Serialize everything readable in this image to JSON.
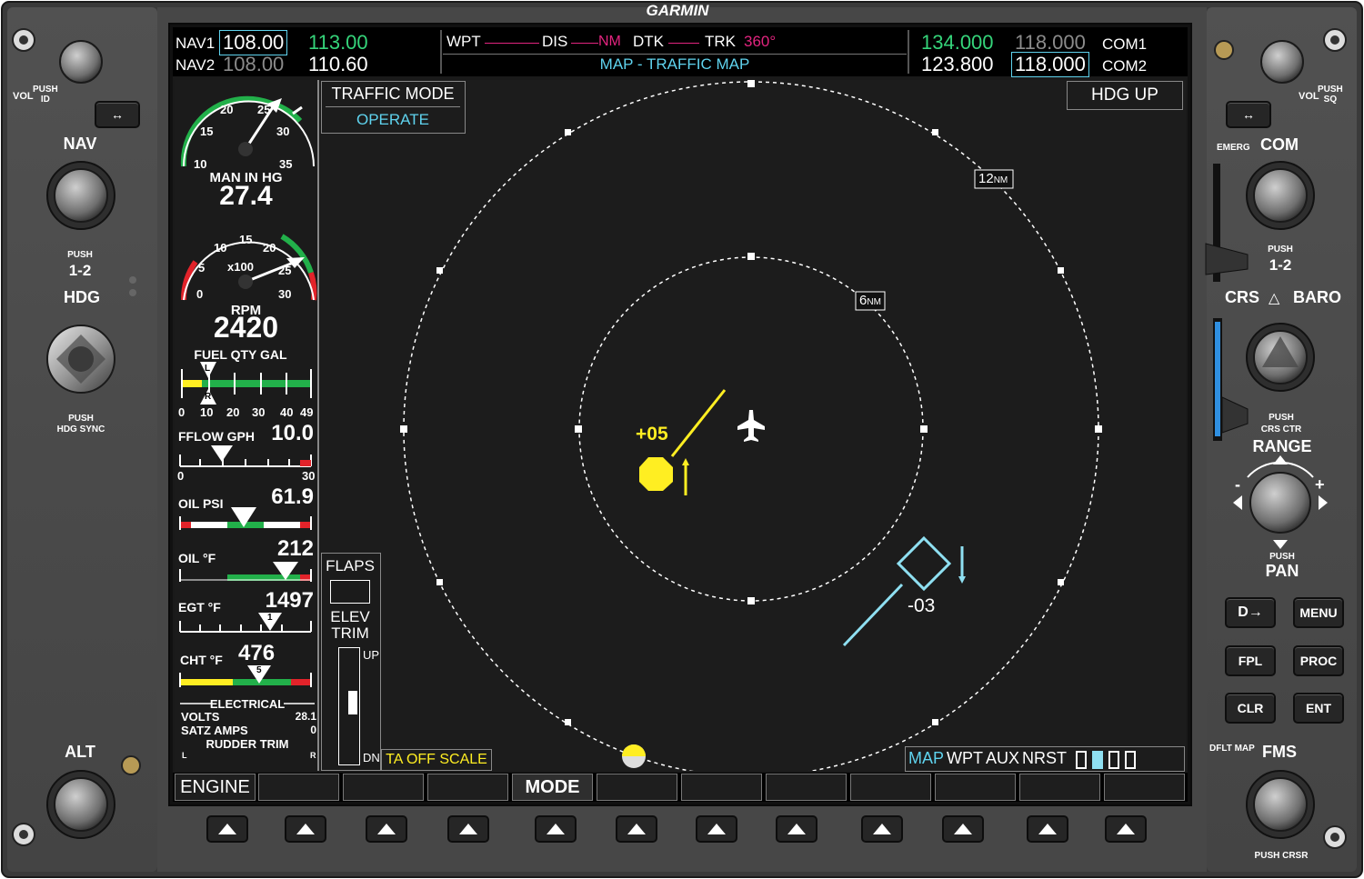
{
  "brand": "GARMIN",
  "nav": {
    "nav1_label": "NAV1",
    "nav1_active": "108.00",
    "nav1_standby": "113.00",
    "nav2_label": "NAV2",
    "nav2_active": "108.00",
    "nav2_standby": "110.60"
  },
  "nav_bar": {
    "wpt": "WPT",
    "dis": "DIS",
    "dis_unit": "NM",
    "dtk": "DTK",
    "trk": "TRK",
    "trk_value": "360°",
    "page_title": "MAP - TRAFFIC MAP"
  },
  "com": {
    "com1_active": "134.000",
    "com1_standby": "118.000",
    "com1_label": "COM1",
    "com2_active": "123.800",
    "com2_standby": "118.000",
    "com2_label": "COM2"
  },
  "map": {
    "traffic_mode_label": "TRAFFIC MODE",
    "traffic_mode_value": "OPERATE",
    "orientation": "HDG UP",
    "ring_outer": "12",
    "ring_inner": "6",
    "ring_unit": "NM",
    "ta_scale": "TA OFF SCALE",
    "target1_alt": "+05",
    "target2_alt": "-03",
    "page_groups": [
      "MAP",
      "WPT",
      "AUX",
      "NRST"
    ]
  },
  "eis": {
    "map_gauge_ticks": [
      "10",
      "15",
      "20",
      "25",
      "30",
      "35"
    ],
    "map_label": "MAN IN HG",
    "map_value": "27.4",
    "rpm_ticks": [
      "0",
      "5",
      "10",
      "15",
      "20",
      "25",
      "30"
    ],
    "rpm_mult": "x100",
    "rpm_label": "RPM",
    "rpm_value": "2420",
    "fuel_label": "FUEL QTY GAL",
    "fuel_left": "L",
    "fuel_right": "R",
    "fuel_ticks": [
      "0",
      "10",
      "20",
      "30",
      "40",
      "49"
    ],
    "fflow_label": "FFLOW GPH",
    "fflow_value": "10.0",
    "fflow_min": "0",
    "fflow_max": "30",
    "oilpsi_label": "OIL PSI",
    "oilpsi_value": "61.9",
    "oilf_label": "OIL °F",
    "oilf_value": "212",
    "egt_label": "EGT °F",
    "egt_value": "1497",
    "egt_cyl": "1",
    "cht_label": "CHT °F",
    "cht_value": "476",
    "cht_cyl": "5",
    "electrical_label": "ELECTRICAL",
    "volts_label": "VOLTS",
    "volts_value": "28.1",
    "amps_label": "SATZ AMPS",
    "amps_value": "0",
    "rudder_label": "RUDDER TRIM",
    "rudder_l": "L",
    "rudder_r": "R",
    "flaps_label": "FLAPS",
    "elev_label1": "ELEV",
    "elev_label2": "TRIM",
    "trim_up": "UP",
    "trim_dn": "DN"
  },
  "softkeys": [
    "ENGINE",
    "",
    "",
    "",
    "MODE",
    "",
    "",
    "",
    "",
    "",
    "",
    ""
  ],
  "left_panel": {
    "vol_label": "VOL",
    "push_id": "PUSH\nID",
    "nav": "NAV",
    "push12_label": "PUSH",
    "push12": "1-2",
    "hdg": "HDG",
    "push_hdg_sync1": "PUSH",
    "push_hdg_sync2": "HDG SYNC",
    "alt": "ALT"
  },
  "right_panel": {
    "vol_label": "VOL",
    "push_sq": "PUSH\nSQ",
    "emerg": "EMERG",
    "com": "COM",
    "push12_label": "PUSH",
    "push12": "1-2",
    "crs": "CRS",
    "baro": "BARO",
    "push_crs_ctr1": "PUSH",
    "push_crs_ctr2": "CRS CTR",
    "range": "RANGE",
    "minus": "-",
    "plus": "+",
    "push_pan1": "PUSH",
    "pan": "PAN",
    "menu": "MENU",
    "fpl": "FPL",
    "proc": "PROC",
    "clr": "CLR",
    "ent": "ENT",
    "dflt_map": "DFLT MAP",
    "fms": "FMS",
    "push_crsr": "PUSH CRSR"
  }
}
